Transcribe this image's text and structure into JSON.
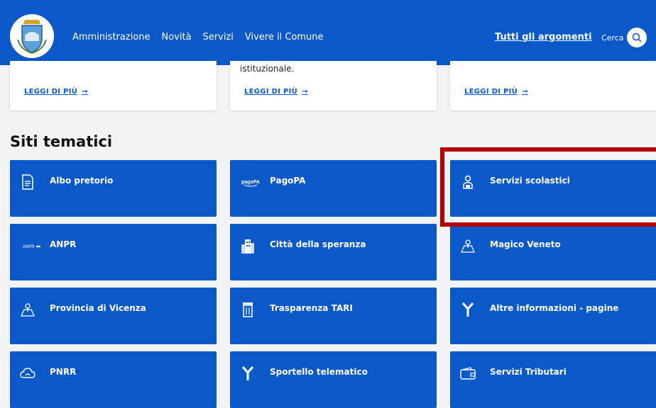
{
  "header": {
    "nav": [
      "Amministrazione",
      "Novità",
      "Servizi",
      "Vivere il Comune"
    ],
    "topics": "Tutti gli argomenti",
    "search_label": "Cerca"
  },
  "cards": [
    {
      "snippet": "",
      "more": "LEGGI DI PIÙ"
    },
    {
      "snippet": "istituzionale.",
      "more": "LEGGI DI PIÙ"
    },
    {
      "snippet": "",
      "more": "LEGGI DI PIÙ"
    }
  ],
  "section_title": "Siti tematici",
  "tiles": [
    {
      "label": "Albo pretorio",
      "icon": "document-icon"
    },
    {
      "label": "PagoPA",
      "icon": "pagopa-logo"
    },
    {
      "label": "Servizi scolastici",
      "icon": "student-icon"
    },
    {
      "label": "ANPR",
      "icon": "anpr-logo"
    },
    {
      "label": "Città della speranza",
      "icon": "building-icon"
    },
    {
      "label": "Magico Veneto",
      "icon": "map-pin-icon"
    },
    {
      "label": "Provincia di Vicenza",
      "icon": "map-pin-icon"
    },
    {
      "label": "Trasparenza TARI",
      "icon": "trash-icon"
    },
    {
      "label": "Altre informazioni - pagine",
      "icon": "fork-icon"
    },
    {
      "label": "PNRR",
      "icon": "cloud-icon"
    },
    {
      "label": "Sportello telematico",
      "icon": "fork-icon"
    },
    {
      "label": "Servizi Tributari",
      "icon": "wallet-icon"
    }
  ],
  "colors": {
    "primary": "#0b59c9",
    "highlight": "#b30000",
    "background": "#f2f3f5"
  }
}
